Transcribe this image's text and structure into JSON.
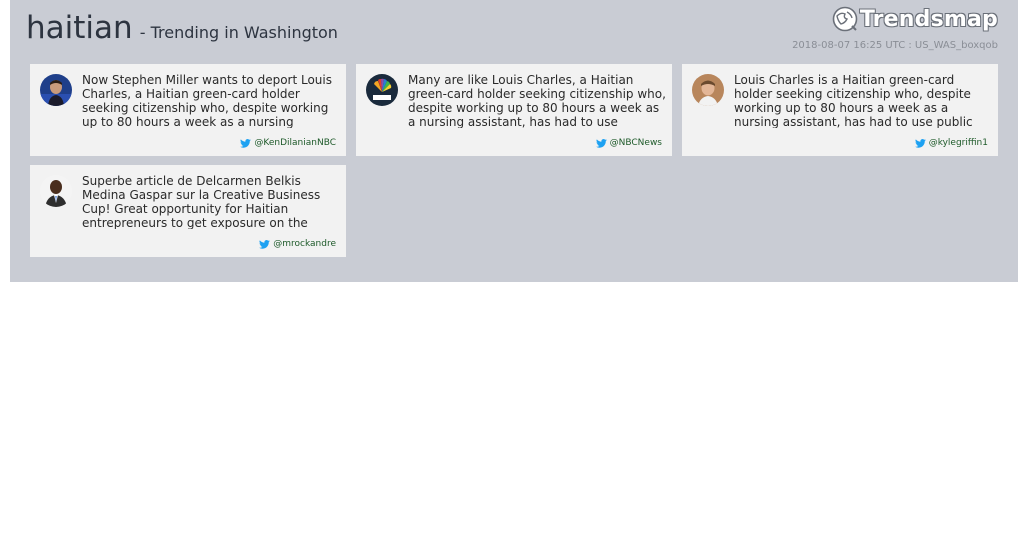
{
  "header": {
    "term": "haitian",
    "subtitle": "- Trending in Washington",
    "brand": "Trendsmap",
    "meta": "2018-08-07 16:25 UTC : US_WAS_boxqob"
  },
  "tweets": [
    {
      "text": "Now Stephen Miller wants to deport Louis Charles, a Haitian green-card holder seeking citizenship who, despite working up to 80 hours a week as a nursing assistant, has had to use...",
      "handle": "@KenDilanianNBC"
    },
    {
      "text": "Many are like Louis Charles, a Haitian green-card holder seeking citizenship who, despite working up to 80 hours a week as a nursing assistant, has had to use public...",
      "handle": "@NBCNews"
    },
    {
      "text": "Louis Charles is a Haitian green-card holder seeking citizenship who, despite working up to 80 hours a week as a nursing assistant, has had to use public assistance...",
      "handle": "@kylegriffin1"
    },
    {
      "text": "Superbe article de Delcarmen Belkis Medina Gaspar sur la Creative Business Cup! Great opportunity for Haitian entrepreneurs to get exposure on the world stage...",
      "handle": "@mrockandre"
    }
  ],
  "colors": {
    "panel": "#c9ccd4",
    "card": "#f2f2f2",
    "handle": "#1e5a2a",
    "twitter": "#1da1f2"
  },
  "icons": {
    "brand": "trendsmap-logo-icon",
    "twitter": "twitter-bird-icon"
  }
}
